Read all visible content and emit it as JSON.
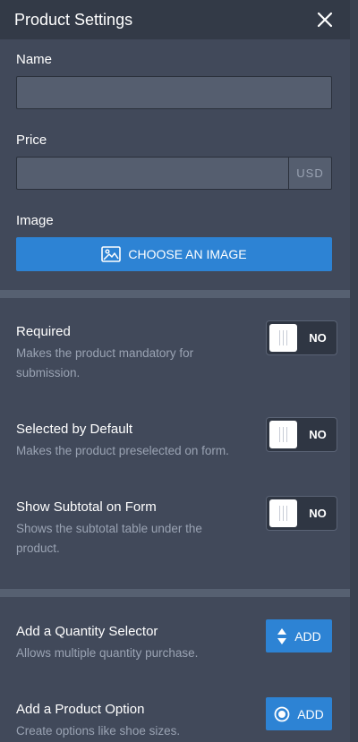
{
  "header": {
    "title": "Product Settings",
    "close_icon": "close-icon"
  },
  "fields": {
    "name_label": "Name",
    "name_value": "",
    "price_label": "Price",
    "price_value": "",
    "currency": "USD",
    "image_label": "Image",
    "choose_image_label": "CHOOSE AN IMAGE"
  },
  "options": [
    {
      "title": "Required",
      "description": "Makes the product mandatory for submission.",
      "state": "NO"
    },
    {
      "title": "Selected by Default",
      "description": "Makes the product preselected on form.",
      "state": "NO"
    },
    {
      "title": "Show Subtotal on Form",
      "description": "Shows the subtotal table under the product.",
      "state": "NO"
    }
  ],
  "addons": [
    {
      "title": "Add a Quantity Selector",
      "description": "Allows multiple quantity purchase.",
      "button_label": "ADD",
      "icon": "up-down-arrows-icon"
    },
    {
      "title": "Add a Product Option",
      "description": "Create options like shoe sizes.",
      "button_label": "ADD",
      "icon": "radio-icon"
    }
  ],
  "colors": {
    "background": "#41495a",
    "header": "#333a47",
    "accent": "#2d83d4",
    "muted_text": "#9aa3b3"
  }
}
